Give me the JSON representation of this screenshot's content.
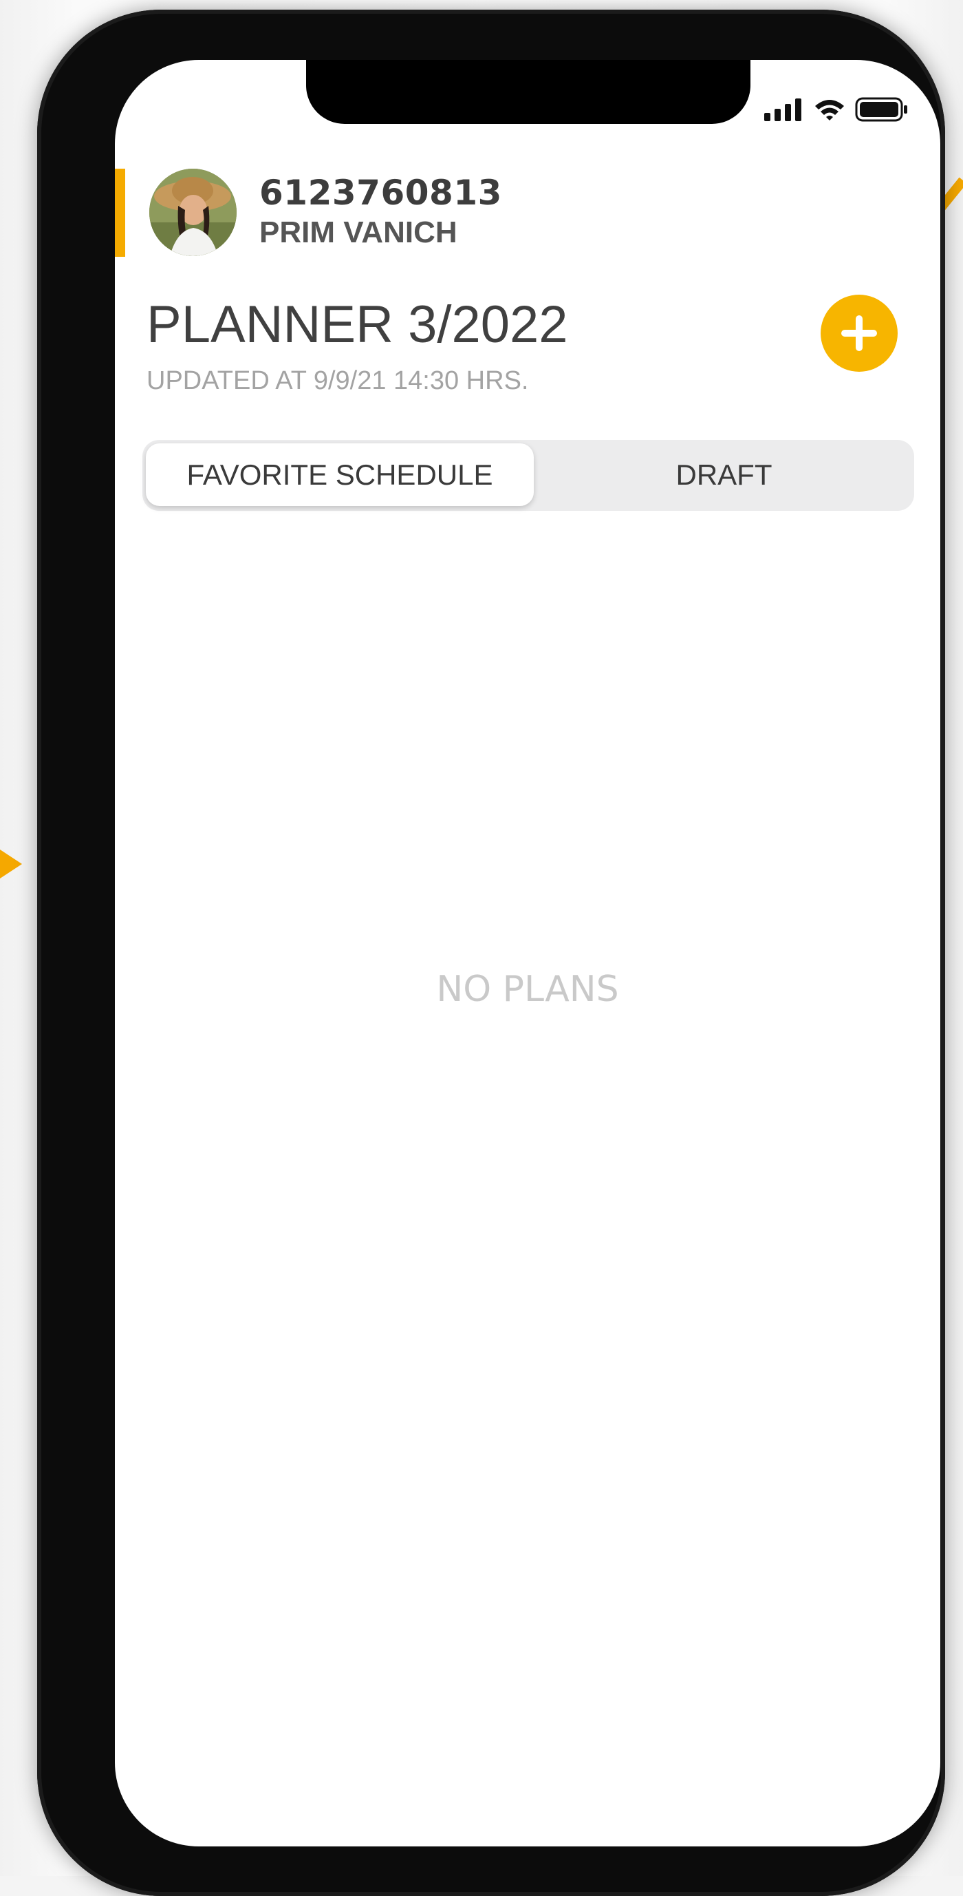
{
  "profile": {
    "id": "6123760813",
    "name": "PRIM VANICH"
  },
  "planner": {
    "title": "PLANNER 3/2022",
    "updated": "UPDATED AT 9/9/21 14:30 HRS."
  },
  "tabs": [
    {
      "label": "FAVORITE SCHEDULE",
      "selected": true
    },
    {
      "label": "DRAFT",
      "selected": false
    }
  ],
  "empty_state": "NO PLANS",
  "colors": {
    "accent": "#F7B500",
    "annotation_arrow": "#F5A800",
    "phone_frame": "#0C0C0C"
  },
  "icons": {
    "add": "plus-icon",
    "status": [
      "cellular-signal-icon",
      "wifi-icon",
      "battery-icon"
    ]
  }
}
